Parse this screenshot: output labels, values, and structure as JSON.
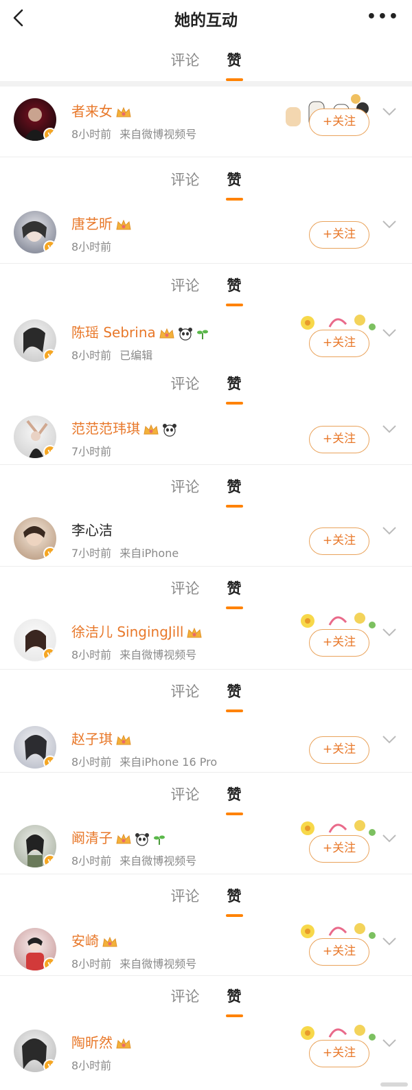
{
  "nav": {
    "title": "她的互动"
  },
  "tabs": {
    "comment": "评论",
    "like": "赞"
  },
  "follow_label": "+关注",
  "rows": [
    {
      "name": "者来女",
      "time": "8小时前",
      "source": "来自微博视频号"
    },
    {
      "name": "唐艺昕",
      "time": "8小时前",
      "source": ""
    },
    {
      "name": "陈瑶 Sebrina",
      "time": "8小时前",
      "source": "已编辑"
    },
    {
      "name": "范范范玮琪",
      "time": "7小时前",
      "source": ""
    },
    {
      "name": "李心洁",
      "time": "7小时前",
      "source": "来自iPhone"
    },
    {
      "name": "徐洁儿 SingingJill",
      "time": "8小时前",
      "source": "来自微博视频号"
    },
    {
      "name": "赵子琪",
      "time": "8小时前",
      "source": "来自iPhone 16 Pro"
    },
    {
      "name": "阚清子",
      "time": "8小时前",
      "source": "来自微博视频号"
    },
    {
      "name": "安崎",
      "time": "8小时前",
      "source": "来自微博视频号"
    },
    {
      "name": "陶昕然",
      "time": "8小时前",
      "source": ""
    }
  ],
  "colors": {
    "accent": "#ff8200",
    "vip_name": "#e8782a",
    "follow_border": "#e9a25a"
  }
}
